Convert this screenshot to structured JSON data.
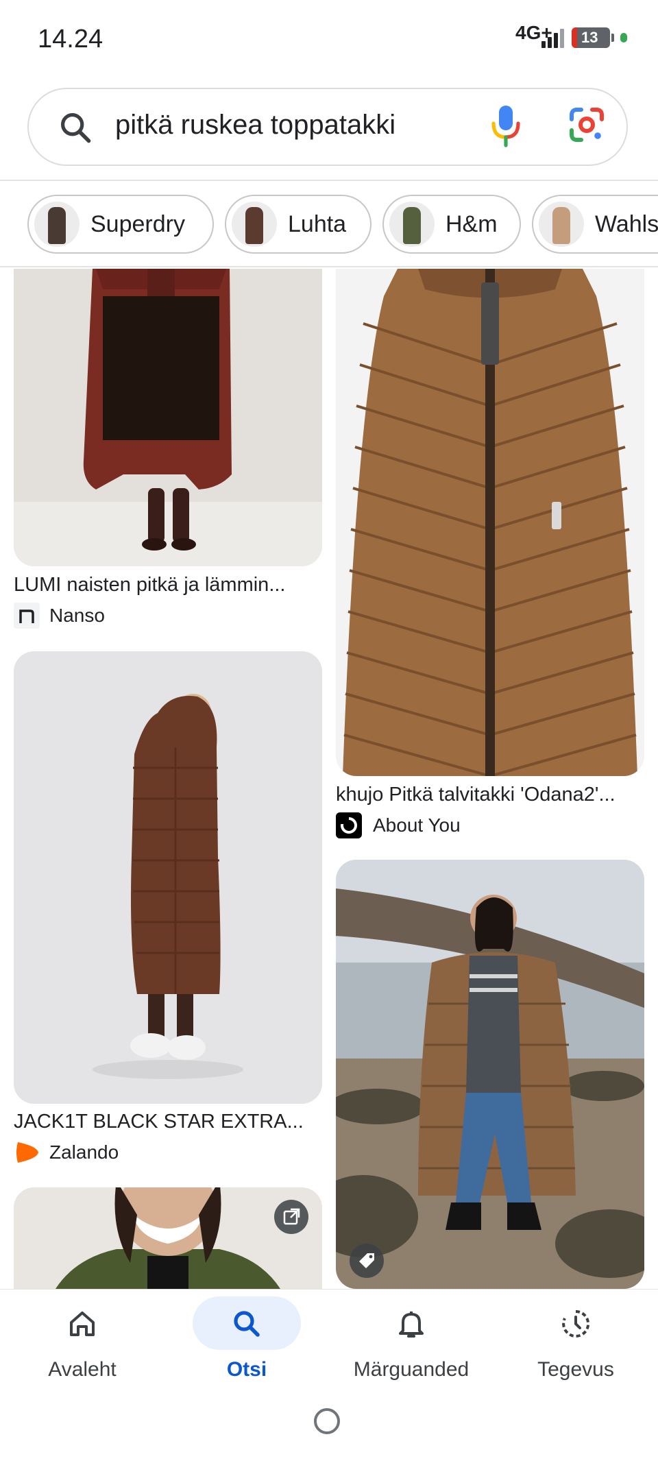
{
  "status_bar": {
    "time": "14.24",
    "network": "4G+",
    "battery": "13"
  },
  "search": {
    "query": "pitkä ruskea toppatakki"
  },
  "chips": [
    {
      "label": "Superdry"
    },
    {
      "label": "Luhta"
    },
    {
      "label": "H&m"
    },
    {
      "label": "Wahls"
    }
  ],
  "results": {
    "left": [
      {
        "title": "LUMI naisten pitkä ja lämmin...",
        "source": "Nanso"
      },
      {
        "title": "JACK1T BLACK STAR EXTRA...",
        "source": "Zalando"
      }
    ],
    "right": [
      {
        "title": "khujo Pitkä talvitakki 'Odana2'...",
        "source": "About You"
      }
    ]
  },
  "nav": {
    "home": "Avaleht",
    "search": "Otsi",
    "notifications": "Märguanded",
    "activity": "Tegevus"
  },
  "colors": {
    "accent": "#0b57d0",
    "accent_bg": "#e8f0fe",
    "coat_brown": "#8a5a35"
  }
}
